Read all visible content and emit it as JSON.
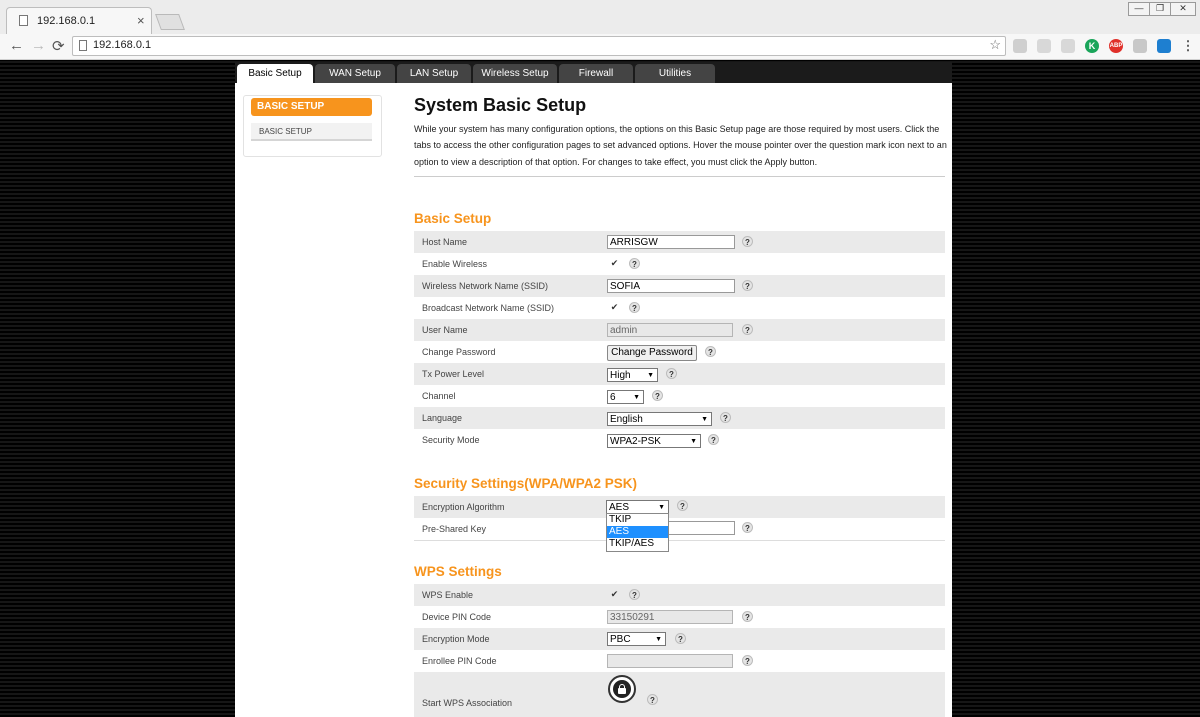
{
  "browser": {
    "tab_title": "192.168.0.1",
    "tab_close": "×",
    "url": "192.168.0.1",
    "window_controls": [
      "—",
      "❐",
      "✕"
    ],
    "nav": {
      "back": "←",
      "forward": "→",
      "reload": "⟳",
      "star": "☆"
    },
    "extensions": [
      {
        "name": "extension-icon-1",
        "label": "",
        "color": "#cfcfcf"
      },
      {
        "name": "extension-icon-2",
        "label": "",
        "color": "#d8d8d8"
      },
      {
        "name": "extension-icon-3",
        "label": "",
        "color": "#d8d8d8"
      },
      {
        "name": "k-extension-icon",
        "label": "K",
        "color": "#1aa55a"
      },
      {
        "name": "abp-extension-icon",
        "label": "ABP",
        "color": "#e0302a"
      },
      {
        "name": "extension-icon-6",
        "label": "",
        "color": "#c8c8c8"
      },
      {
        "name": "extension-icon-7",
        "label": "",
        "color": "#1e7fd0"
      },
      {
        "name": "menu-icon",
        "label": "⋮",
        "color": "#f7f7f7"
      }
    ]
  },
  "nav_tabs": [
    "Basic Setup",
    "WAN Setup",
    "LAN Setup",
    "Wireless Setup",
    "Firewall",
    "Utilities"
  ],
  "sidebar": {
    "header": "BASIC SETUP",
    "item": "BASIC SETUP"
  },
  "page": {
    "title": "System Basic Setup",
    "intro": "While your system has many configuration options, the options on this Basic Setup page are those required by most users. Click the tabs to access the other configuration pages to set advanced options. Hover the mouse pointer over the question mark icon next to an option to view a description of that option. For changes to take effect, you must click the Apply button."
  },
  "help_glyph": "?",
  "check_glyph": "✔",
  "basic_setup": {
    "title": "Basic Setup",
    "host_name": {
      "label": "Host Name",
      "value": "ARRISGW"
    },
    "enable_wireless": {
      "label": "Enable Wireless"
    },
    "ssid": {
      "label": "Wireless Network Name (SSID)",
      "value": "SOFIA"
    },
    "broadcast_ssid": {
      "label": "Broadcast Network Name (SSID)"
    },
    "user_name": {
      "label": "User Name",
      "value": "admin"
    },
    "change_password": {
      "label": "Change Password",
      "button": "Change Password"
    },
    "tx_power": {
      "label": "Tx Power Level",
      "value": "High"
    },
    "channel": {
      "label": "Channel",
      "value": "6"
    },
    "language": {
      "label": "Language",
      "value": "English"
    },
    "security_mode": {
      "label": "Security Mode",
      "value": "WPA2-PSK"
    }
  },
  "security_settings": {
    "title": "Security Settings(WPA/WPA2 PSK)",
    "encryption": {
      "label": "Encryption Algorithm",
      "value": "AES",
      "options": [
        "TKIP",
        "AES",
        "TKIP/AES"
      ]
    },
    "psk": {
      "label": "Pre-Shared Key"
    }
  },
  "wps_settings": {
    "title": "WPS Settings",
    "wps_enable": {
      "label": "WPS Enable"
    },
    "device_pin": {
      "label": "Device PIN Code",
      "value": "33150291"
    },
    "encryption_mode": {
      "label": "Encryption Mode",
      "value": "PBC"
    },
    "enrollee_pin": {
      "label": "Enrollee PIN Code",
      "value": ""
    },
    "start_wps": {
      "label": "Start WPS Association"
    }
  }
}
